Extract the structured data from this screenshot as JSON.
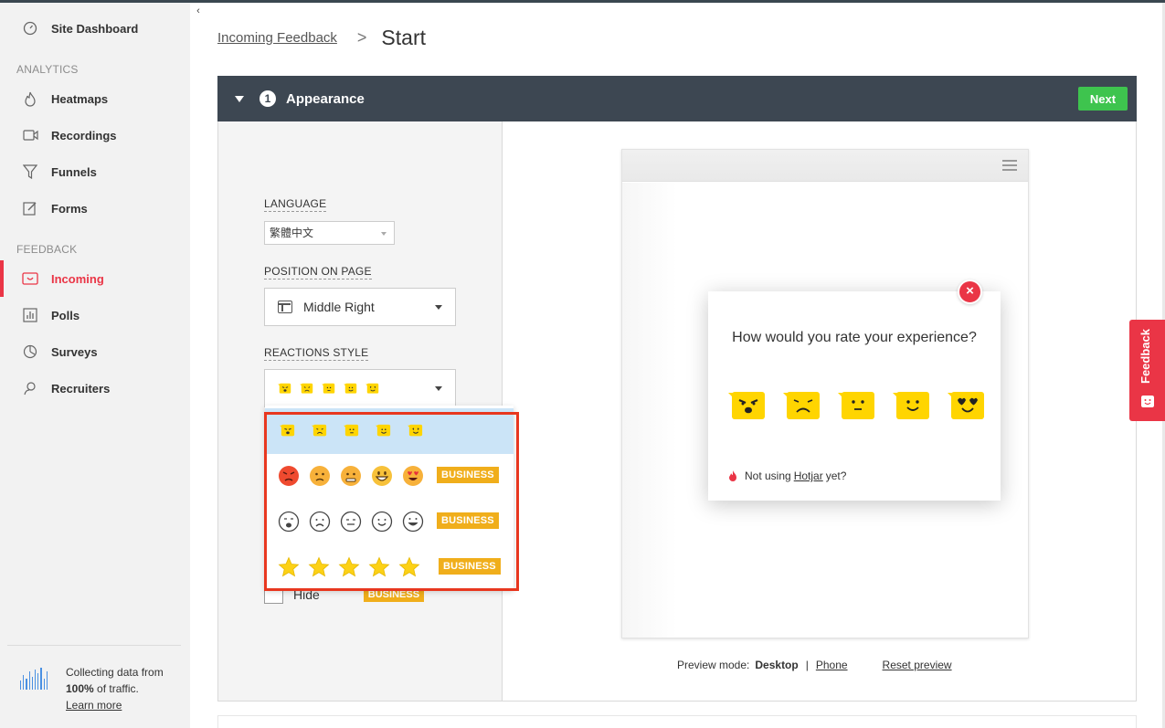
{
  "sidebar": {
    "items": [
      {
        "label": "Site Dashboard",
        "icon": "dashboard-icon"
      },
      {
        "label": "Heatmaps",
        "icon": "flame-icon"
      },
      {
        "label": "Recordings",
        "icon": "video-icon"
      },
      {
        "label": "Funnels",
        "icon": "funnel-icon"
      },
      {
        "label": "Forms",
        "icon": "form-icon"
      },
      {
        "label": "Incoming",
        "icon": "incoming-icon"
      },
      {
        "label": "Polls",
        "icon": "poll-icon"
      },
      {
        "label": "Surveys",
        "icon": "survey-icon"
      },
      {
        "label": "Recruiters",
        "icon": "recruiter-icon"
      }
    ],
    "headings": {
      "analytics": "ANALYTICS",
      "feedback": "FEEDBACK"
    },
    "collect": {
      "line1": "Collecting data from",
      "percent": "100%",
      "line2_rest": " of traffic.",
      "link": "Learn more"
    },
    "collapse_glyph": "‹"
  },
  "breadcrumb": {
    "parent": "Incoming Feedback",
    "separator": ">",
    "current": "Start"
  },
  "step": {
    "number": "1",
    "title": "Appearance",
    "next_label": "Next"
  },
  "form": {
    "language_label": "LANGUAGE",
    "language_value": "繁體中文",
    "position_label": "POSITION ON PAGE",
    "position_value": "Middle Right",
    "reactions_label": "REACTIONS STYLE",
    "business_badge": "BUSINESS",
    "hide_label": "Hide"
  },
  "preview": {
    "question": "How would you rate your experience?",
    "footer_prefix": "Not using",
    "footer_link": "Hotjar",
    "footer_suffix": "yet?",
    "close_glyph": "×",
    "mode_label": "Preview mode:",
    "mode_desktop": "Desktop",
    "mode_sep": "|",
    "mode_phone": "Phone",
    "reset": "Reset preview"
  },
  "feedback_tab": {
    "label": "Feedback"
  },
  "colors": {
    "accent": "#ea3546",
    "header": "#3d4752",
    "next": "#3ec44e",
    "badge": "#f0ae1b",
    "selected_row": "#cbe4f7",
    "highlight": "#e8371f"
  }
}
